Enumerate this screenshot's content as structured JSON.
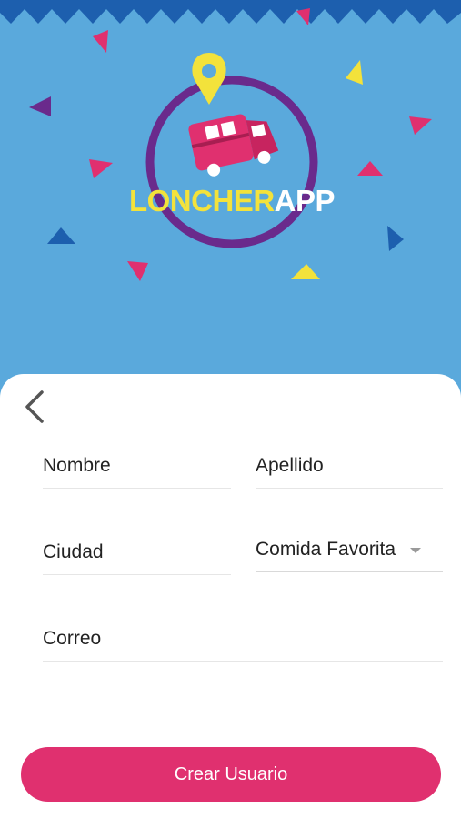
{
  "logo": {
    "text_part1": "LONCHER",
    "text_part2": "APP"
  },
  "form": {
    "nombre_placeholder": "Nombre",
    "apellido_placeholder": "Apellido",
    "ciudad_placeholder": "Ciudad",
    "comida_selected": "Comida Favorita",
    "correo_placeholder": "Correo"
  },
  "actions": {
    "submit_label": "Crear Usuario"
  },
  "colors": {
    "background": "#5aa9dc",
    "accent": "#e0306f",
    "ring": "#6a2a8c",
    "pin": "#f3e23b"
  }
}
